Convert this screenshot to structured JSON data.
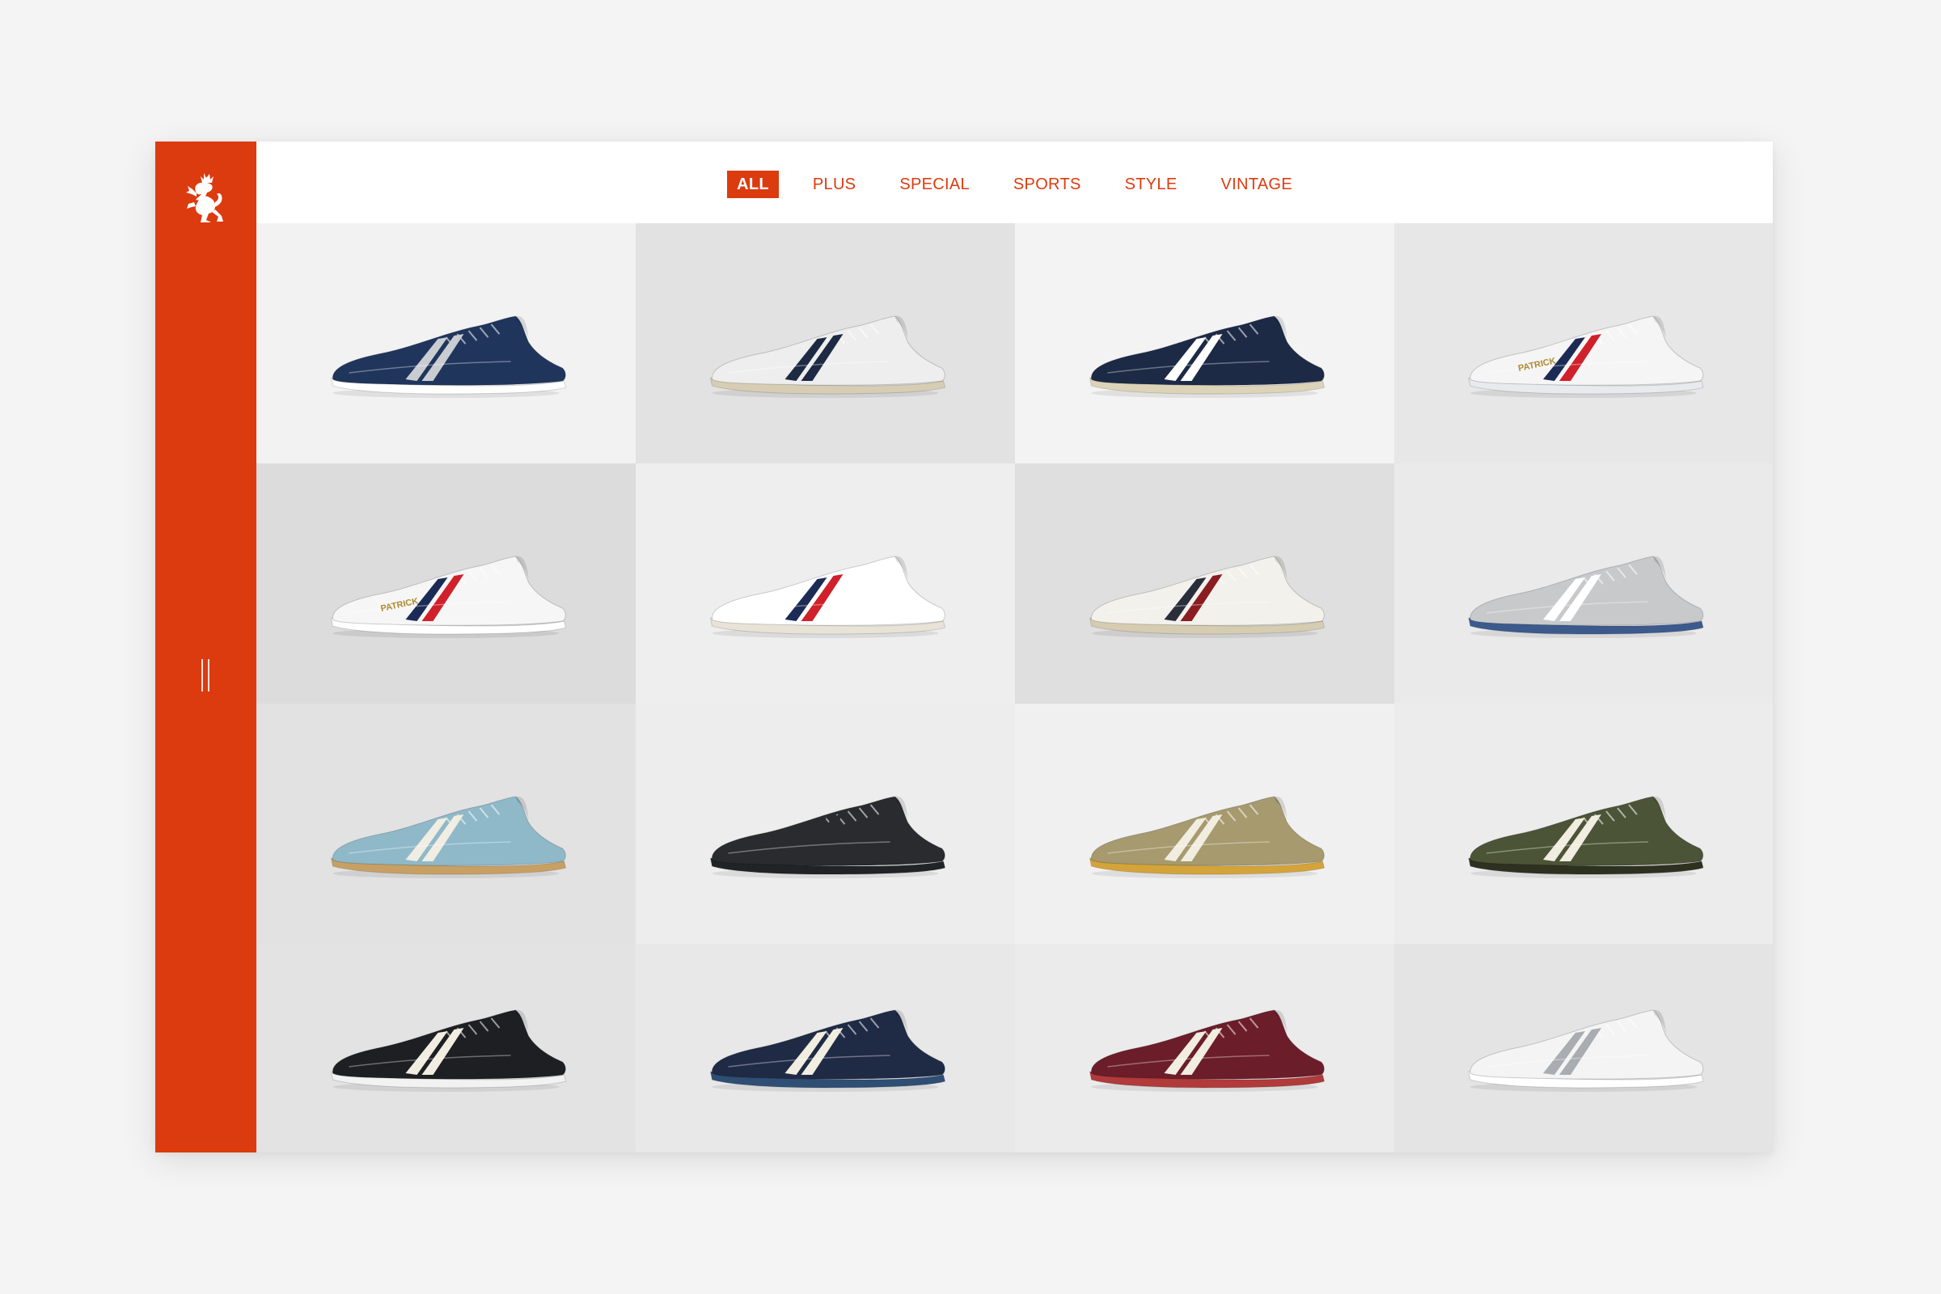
{
  "brand": {
    "logo_icon": "lion-rampant-icon",
    "accent": "#dc3b0f"
  },
  "nav": {
    "menu_icon": "menu-toggle-icon",
    "tabs": [
      {
        "label": "ALL",
        "active": true
      },
      {
        "label": "PLUS",
        "active": false
      },
      {
        "label": "SPECIAL",
        "active": false
      },
      {
        "label": "SPORTS",
        "active": false
      },
      {
        "label": "STYLE",
        "active": false
      },
      {
        "label": "VINTAGE",
        "active": false
      }
    ]
  },
  "products": [
    {
      "bg": "#f2f2f3",
      "upper": "#1f355c",
      "sole": "#ffffff",
      "stripe": [
        "#c9cdd1",
        "#c9cdd1"
      ],
      "wordmark": ""
    },
    {
      "bg": "#e2e2e3",
      "upper": "#eeeeee",
      "sole": "#d6cdb4",
      "stripe": [
        "#1e2a44",
        "#1e2a44"
      ],
      "wordmark": ""
    },
    {
      "bg": "#f3f3f4",
      "upper": "#1c2a45",
      "sole": "#ddd3b8",
      "stripe": [
        "#ffffff",
        "#ffffff"
      ],
      "wordmark": ""
    },
    {
      "bg": "#e7e7e8",
      "upper": "#f5f5f5",
      "sole": "#e8eaee",
      "stripe": [
        "#1b2b55",
        "#d0202b"
      ],
      "wordmark": "PATRICK"
    },
    {
      "bg": "#dcdcdd",
      "upper": "#f6f6f6",
      "sole": "#ffffff",
      "stripe": [
        "#1b2b55",
        "#d0202b"
      ],
      "wordmark": "PATRICK"
    },
    {
      "bg": "#eeeeef",
      "upper": "#ffffff",
      "sole": "#e8e3d6",
      "stripe": [
        "#1b2b55",
        "#d0202b"
      ],
      "wordmark": ""
    },
    {
      "bg": "#dfdfe0",
      "upper": "#f2f1ec",
      "sole": "#d6ccb1",
      "stripe": [
        "#2a2d3a",
        "#8a1c22"
      ],
      "wordmark": ""
    },
    {
      "bg": "#eaeaeb",
      "upper": "#c8c9cb",
      "sole": "#3c5a8c",
      "stripe": [
        "#ffffff",
        "#ffffff"
      ],
      "wordmark": ""
    },
    {
      "bg": "#e2e2e3",
      "upper": "#8fb9c8",
      "sole": "#c8a063",
      "stripe": [
        "#f0ede2",
        "#f0ede2"
      ],
      "wordmark": ""
    },
    {
      "bg": "#ededee",
      "upper": "#2a2b2e",
      "sole": "#222326",
      "stripe": [
        "#2a2b2e",
        "#2a2b2e"
      ],
      "wordmark": ""
    },
    {
      "bg": "#f0f0f1",
      "upper": "#a69a6e",
      "sole": "#d4a43a",
      "stripe": [
        "#f1ede0",
        "#f1ede0"
      ],
      "wordmark": ""
    },
    {
      "bg": "#ececed",
      "upper": "#4b5436",
      "sole": "#2e3120",
      "stripe": [
        "#f1ede0",
        "#f1ede0"
      ],
      "wordmark": ""
    },
    {
      "bg": "#e3e3e4",
      "upper": "#1d1f22",
      "sole": "#f2f2f2",
      "stripe": [
        "#f1ede0",
        "#f1ede0"
      ],
      "wordmark": ""
    },
    {
      "bg": "#e8e8e9",
      "upper": "#1f2b45",
      "sole": "#2f4e74",
      "stripe": [
        "#f1ede0",
        "#f1ede0"
      ],
      "wordmark": ""
    },
    {
      "bg": "#ebebec",
      "upper": "#6c1d2a",
      "sole": "#b13a3a",
      "stripe": [
        "#f1ede0",
        "#f1ede0"
      ],
      "wordmark": ""
    },
    {
      "bg": "#e4e4e5",
      "upper": "#f4f4f4",
      "sole": "#ffffff",
      "stripe": [
        "#a9acb0",
        "#a9acb0"
      ],
      "wordmark": ""
    }
  ]
}
